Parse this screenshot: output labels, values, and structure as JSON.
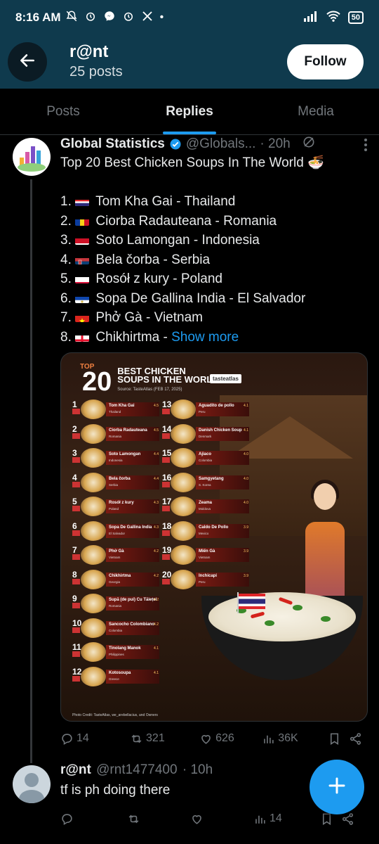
{
  "status_bar": {
    "time": "8:16 AM",
    "battery": "50",
    "icons": [
      "mute-icon",
      "alarm-icon",
      "messenger-icon",
      "alarm-icon",
      "x-icon",
      "dot-icon",
      "signal-icon",
      "wifi-icon",
      "battery-icon"
    ]
  },
  "header": {
    "title": "r@nt",
    "subtitle": "25 posts",
    "follow_label": "Follow"
  },
  "tabs": [
    {
      "label": "Posts",
      "active": false
    },
    {
      "label": "Replies",
      "active": true
    },
    {
      "label": "Media",
      "active": false
    }
  ],
  "post": {
    "author": "Global Statistics",
    "handle": "@Globals...",
    "time": "· 20h",
    "title_line": "Top 20 Best Chicken Soups In The World 🍜",
    "items": [
      {
        "num": "1.",
        "text": "Tom Kha Gai - Thailand"
      },
      {
        "num": "2.",
        "text": "Ciorba Radauteana - Romania"
      },
      {
        "num": "3.",
        "text": "Soto Lamongan - Indonesia"
      },
      {
        "num": "4.",
        "text": "Bela čorba - Serbia"
      },
      {
        "num": "5.",
        "text": "Rosół z kury - Poland"
      },
      {
        "num": "6.",
        "text": "Sopa De Gallina India - El Salvador"
      },
      {
        "num": "7.",
        "text": "Phở Gà - Vietnam"
      },
      {
        "num": "8.",
        "text": "Chikhirtma - "
      }
    ],
    "show_more": "Show more",
    "stats": {
      "replies": "14",
      "reposts": "321",
      "likes": "626",
      "views": "36K"
    }
  },
  "infographic": {
    "top_label": "TOP",
    "number": "20",
    "title_line1": "BEST CHICKEN",
    "title_line2": "SOUPS IN THE WORLD!",
    "source": "Source: TasteAtlas   (FEB 17, 2025)",
    "logo": "tasteatlas",
    "photo_credit": "Photo Credit: TasteAtlas, we_arebellacius, and Owners",
    "soups": [
      {
        "rank": "1",
        "name": "Tom Kha Gai",
        "country": "Thailand",
        "score": "4.5"
      },
      {
        "rank": "2",
        "name": "Ciorba Radauteana",
        "country": "Romania",
        "score": "4.5"
      },
      {
        "rank": "3",
        "name": "Soto Lamongan",
        "country": "Indonesia",
        "score": "4.4"
      },
      {
        "rank": "4",
        "name": "Bela čorba",
        "country": "Serbia",
        "score": "4.4"
      },
      {
        "rank": "5",
        "name": "Rosół z kury",
        "country": "Poland",
        "score": "4.3"
      },
      {
        "rank": "6",
        "name": "Sopa De Gallina India",
        "country": "El Salvador",
        "score": "4.3"
      },
      {
        "rank": "7",
        "name": "Phở Gà",
        "country": "Vietnam",
        "score": "4.2"
      },
      {
        "rank": "8",
        "name": "Chikhirtma",
        "country": "Georgia",
        "score": "4.2"
      },
      {
        "rank": "9",
        "name": "Supă (de pui) Cu Tăieței",
        "country": "Romania",
        "score": "4.2"
      },
      {
        "rank": "10",
        "name": "Sancocho Colombiano",
        "country": "Colombia",
        "score": "4.2"
      },
      {
        "rank": "11",
        "name": "Tinolang Manok",
        "country": "Philippines",
        "score": "4.1"
      },
      {
        "rank": "12",
        "name": "Kotosoupa",
        "country": "Greece",
        "score": "4.1"
      },
      {
        "rank": "13",
        "name": "Aguadito de pollo",
        "country": "Peru",
        "score": "4.1"
      },
      {
        "rank": "14",
        "name": "Danish Chicken Soup",
        "country": "Denmark",
        "score": "4.1"
      },
      {
        "rank": "15",
        "name": "Ajiaco",
        "country": "Colombia",
        "score": "4.0"
      },
      {
        "rank": "16",
        "name": "Samgyetang",
        "country": "S. Korea",
        "score": "4.0"
      },
      {
        "rank": "17",
        "name": "Zeama",
        "country": "Moldova",
        "score": "4.0"
      },
      {
        "rank": "18",
        "name": "Caldo De Pollo",
        "country": "Mexico",
        "score": "3.9"
      },
      {
        "rank": "19",
        "name": "Miến Gà",
        "country": "Vietnam",
        "score": "3.9"
      },
      {
        "rank": "20",
        "name": "Inchicapi",
        "country": "Peru",
        "score": "3.9"
      }
    ]
  },
  "reply": {
    "author": "r@nt",
    "handle": "@rnt1477400",
    "time": "· 10h",
    "text": "tf is ph doing there",
    "stats": {
      "views": "14"
    }
  },
  "colors": {
    "header_bg": "#0f3a4d",
    "accent": "#1d9bf0",
    "muted": "#71767b",
    "text": "#e7e9ea"
  }
}
